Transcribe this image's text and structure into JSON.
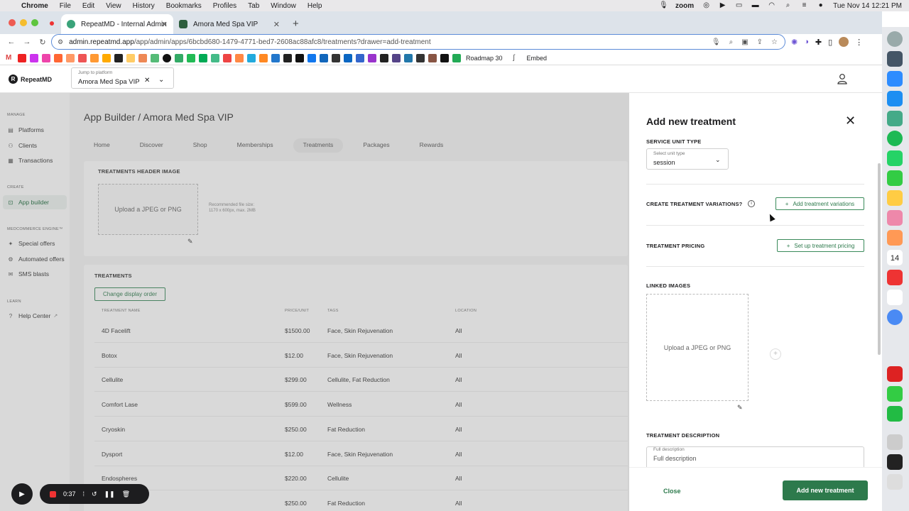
{
  "menubar": {
    "app": "Chrome",
    "items": [
      "File",
      "Edit",
      "View",
      "History",
      "Bookmarks",
      "Profiles",
      "Tab",
      "Window",
      "Help"
    ],
    "zoom_label": "zoom",
    "datetime": "Tue Nov 14  12:21 PM"
  },
  "tabs": [
    {
      "title": "RepeatMD - Internal Admin",
      "color": "#3aa37a"
    },
    {
      "title": "Amora Med Spa VIP",
      "color": "#2e5e3e"
    }
  ],
  "url": {
    "domain": "admin.repeatmd.app",
    "path": "/app/admin/apps/6bcbd680-1479-4771-bed7-2608ac88afc8/treatments?drawer=add-treatment"
  },
  "bookmarks": {
    "roadmap": "Roadmap 30",
    "embed": "Embed"
  },
  "header": {
    "logo_text": "RepeatMD",
    "jump_label": "Jump to platform",
    "jump_value": "Amora Med Spa VIP",
    "clear": "✕",
    "chevron": "⌄"
  },
  "sidenav": {
    "manage_label": "MANAGE",
    "manage": [
      "Platforms",
      "Clients",
      "Transactions"
    ],
    "create_label": "CREATE",
    "create": [
      "App builder"
    ],
    "engine_label": "MEDCOMMERCE ENGINE™",
    "engine": [
      "Special offers",
      "Automated offers",
      "SMS blasts"
    ],
    "learn_label": "LEARN",
    "learn": [
      "Help Center"
    ]
  },
  "main": {
    "breadcrumb": "App Builder  /  Amora Med Spa VIP",
    "tabs": [
      "Home",
      "Discover",
      "Shop",
      "Memberships",
      "Treatments",
      "Packages",
      "Rewards"
    ],
    "active_tab": "Treatments",
    "header_image_title": "TREATMENTS HEADER IMAGE",
    "upload_text": "Upload a JPEG or PNG",
    "hint_line1": "Recommended file size:",
    "hint_line2": "1170 x 600px, max. 2MB",
    "treatments_title": "TREATMENTS",
    "change_order": "Change display order",
    "columns": [
      "TREATMENT NAME",
      "PRICE/UNIT",
      "TAGS",
      "LOCATION"
    ],
    "rows": [
      {
        "name": "4D Facelift",
        "price": "$1500.00",
        "tags": "Face, Skin Rejuvenation",
        "location": "All"
      },
      {
        "name": "Botox",
        "price": "$12.00",
        "tags": "Face, Skin Rejuvenation",
        "location": "All"
      },
      {
        "name": "Cellulite",
        "price": "$299.00",
        "tags": "Cellulite, Fat Reduction",
        "location": "All"
      },
      {
        "name": "Comfort Lase",
        "price": "$599.00",
        "tags": "Wellness",
        "location": "All"
      },
      {
        "name": "Cryoskin",
        "price": "$250.00",
        "tags": "Fat Reduction",
        "location": "All"
      },
      {
        "name": "Dysport",
        "price": "$12.00",
        "tags": "Face, Skin Rejuvenation",
        "location": "All"
      },
      {
        "name": "Endospheres",
        "price": "$220.00",
        "tags": "Cellulite",
        "location": "All"
      },
      {
        "name": "",
        "price": "$250.00",
        "tags": "Fat Reduction",
        "location": "All"
      }
    ]
  },
  "drawer": {
    "title": "Add new treatment",
    "service_unit_type": "SERVICE UNIT TYPE",
    "select_label": "Select unit type",
    "select_value": "session",
    "variations_label": "CREATE TREATMENT VARIATIONS?",
    "variations_button": "Add treatment variations",
    "pricing_label": "TREATMENT PRICING",
    "pricing_button": "Set up treatment pricing",
    "linked_images": "LINKED IMAGES",
    "upload_text": "Upload a JPEG or PNG",
    "description_label": "TREATMENT DESCRIPTION",
    "description_field_label": "Full description",
    "description_placeholder": "Full description",
    "close": "Close",
    "submit": "Add new treatment"
  },
  "recorder": {
    "time": "0:37"
  },
  "colors": {
    "brand_green": "#2d7a4c",
    "calendar_day": "14"
  }
}
